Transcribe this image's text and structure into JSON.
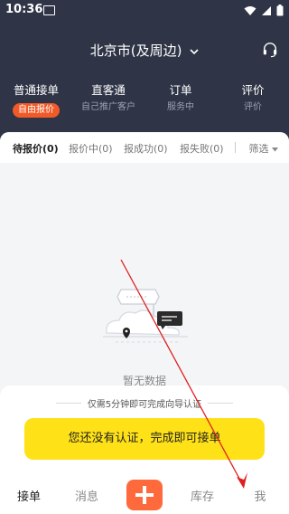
{
  "status_bar": {
    "time": "10:36"
  },
  "header": {
    "city": "北京市(及周边)"
  },
  "tabs": [
    {
      "title": "普通接单",
      "subtitle": "自由报价"
    },
    {
      "title": "直客通",
      "subtitle": "自己推广客户"
    },
    {
      "title": "订单",
      "subtitle": "服务中"
    },
    {
      "title": "评价",
      "subtitle": "评价"
    }
  ],
  "filters": {
    "items": [
      "待报价(0)",
      "报价中(0)",
      "报成功(0)",
      "报失败(0)"
    ],
    "filter_label": "筛选"
  },
  "empty": {
    "text": "暂无数据"
  },
  "verify_card": {
    "note": "仅需5分钟即可完成向导认证",
    "button_label": "您还没有认证，完成即可接单"
  },
  "bottom_nav": {
    "items": [
      "接单",
      "消息",
      "库存",
      "我"
    ]
  },
  "colors": {
    "header_bg": "#2f3546",
    "accent_orange": "#f05a28",
    "cta_yellow": "#ffe117",
    "arrow_red": "#e02020"
  }
}
